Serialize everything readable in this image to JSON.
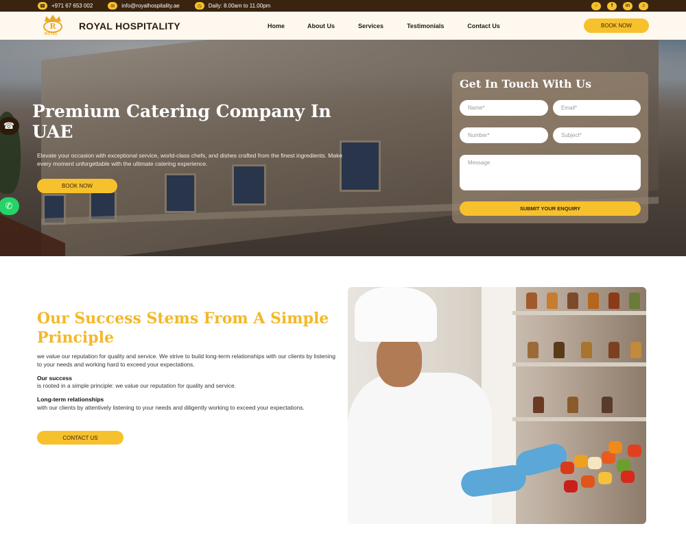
{
  "topbar": {
    "phone": "+971 67 653 002",
    "email": "info@royalhospitality.ae",
    "hours": "Daily: 8.00am to 11.00pm",
    "socials": [
      "instagram",
      "facebook",
      "linkedin",
      "tiktok"
    ]
  },
  "header": {
    "logo_text": "ROYAL",
    "brand": "ROYAL HOSPITALITY",
    "nav": [
      "Home",
      "About Us",
      "Services",
      "Testimonials",
      "Contact Us"
    ],
    "book_label": "BOOK NOW"
  },
  "hero": {
    "title": "Premium Catering Company In UAE",
    "text": "Elevate your occasion with exceptional service, world-class chefs, and dishes crafted from the finest ingredients. Make every moment unforgettable with the ultimate catering experience.",
    "book_label": "BOOK NOW"
  },
  "form": {
    "title": "Get In Touch With Us",
    "name_placeholder": "Name*",
    "email_placeholder": "Email*",
    "number_placeholder": "Number*",
    "subject_placeholder": "Subject*",
    "message_placeholder": "Message",
    "submit_label": "SUBMIT YOUR ENQUIRY"
  },
  "about": {
    "title": "Our Success Stems From A Simple Principle",
    "intro": "we value our reputation for quality and service. We strive to build long-term relationships with our clients by listening to your needs and working hard to exceed your expectations.",
    "h1": "Our success",
    "p1": "is rooted in a simple principle: we value our reputation for quality and service.",
    "h2": "Long-term relationships",
    "p2": "with our clients by attentively listening to your needs and diligently working to exceed your expectations.",
    "contact_label": "CONTACT US"
  },
  "colors": {
    "accent": "#f6c12c",
    "dark_brown": "#3a2410",
    "heading_gold": "#f3b82a"
  }
}
